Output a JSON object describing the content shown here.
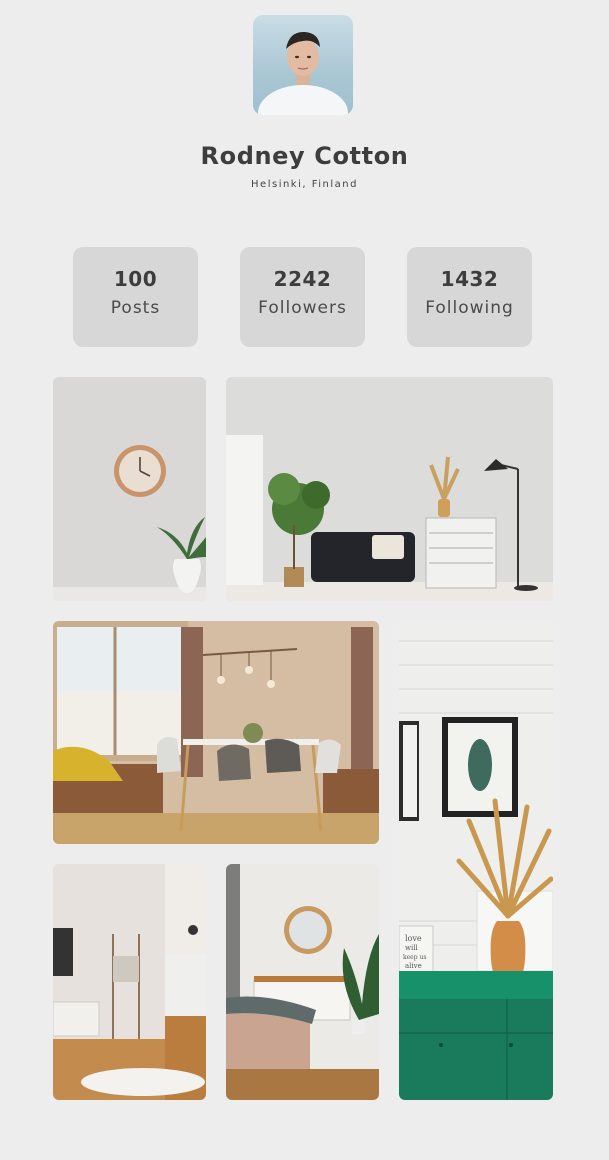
{
  "profile": {
    "name": "Rodney Cotton",
    "location": "Helsinki, Finland"
  },
  "stats": [
    {
      "value": "100",
      "label": "Posts"
    },
    {
      "value": "2242",
      "label": "Followers"
    },
    {
      "value": "1432",
      "label": "Following"
    }
  ],
  "photos": [
    {
      "subject": "wall clock with potted plant"
    },
    {
      "subject": "living room with black sofa, white dresser and floor lamp"
    },
    {
      "subject": "dining room with hanging bulbs"
    },
    {
      "subject": "white brick wall with leaf print and dried pampas in vase on green cabinet"
    },
    {
      "subject": "hallway with blanket ladder"
    },
    {
      "subject": "bedroom with round mirror and plant"
    }
  ],
  "art_text": {
    "sign": [
      "love",
      "will",
      "keep us",
      "alive"
    ]
  }
}
